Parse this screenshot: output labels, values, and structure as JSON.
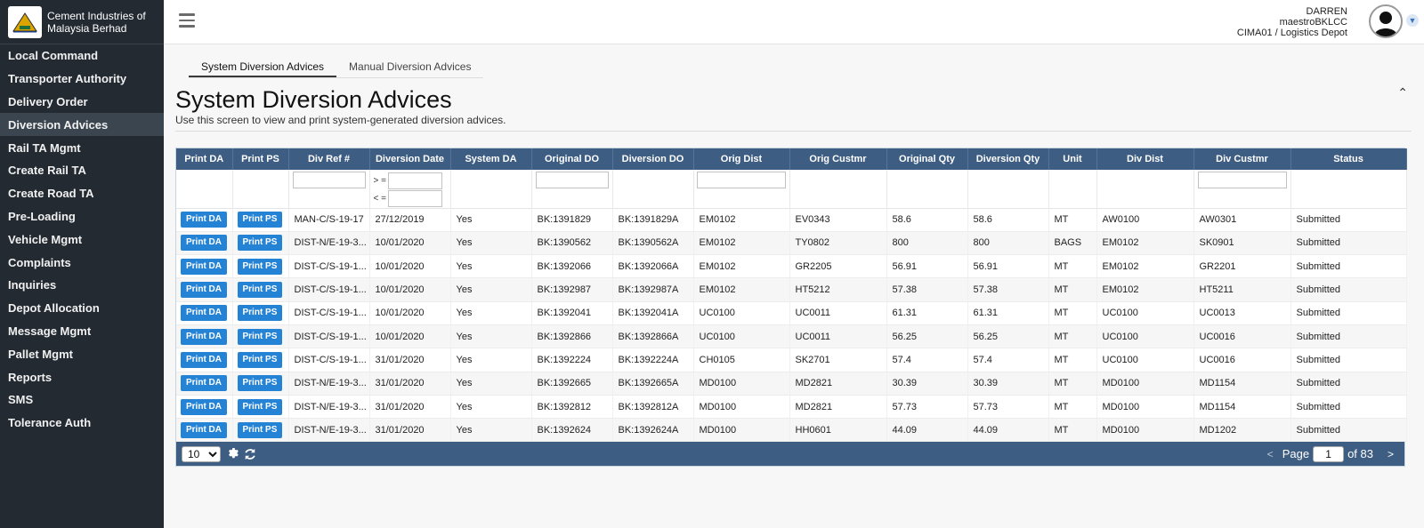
{
  "brand": {
    "name_line1": "Cement Industries of",
    "name_line2": "Malaysia Berhad"
  },
  "sidebar": {
    "items": [
      {
        "label": "Local Command"
      },
      {
        "label": "Transporter Authority"
      },
      {
        "label": "Delivery Order"
      },
      {
        "label": "Diversion Advices"
      },
      {
        "label": "Rail TA Mgmt"
      },
      {
        "label": "Create Rail TA"
      },
      {
        "label": "Create Road TA"
      },
      {
        "label": "Pre-Loading"
      },
      {
        "label": "Vehicle Mgmt"
      },
      {
        "label": "Complaints"
      },
      {
        "label": "Inquiries"
      },
      {
        "label": "Depot Allocation"
      },
      {
        "label": "Message Mgmt"
      },
      {
        "label": "Pallet Mgmt"
      },
      {
        "label": "Reports"
      },
      {
        "label": "SMS"
      },
      {
        "label": "Tolerance Auth"
      }
    ],
    "active_item": "Diversion Advices"
  },
  "header": {
    "user_name": "DARREN",
    "user_id": "maestroBKLCC",
    "user_location": "CIMA01 / Logistics Depot"
  },
  "tabs": [
    {
      "label": "System Diversion Advices"
    },
    {
      "label": "Manual Diversion Advices"
    }
  ],
  "page": {
    "title": "System Diversion Advices",
    "description": "Use this screen to view and print system-generated diversion advices."
  },
  "grid": {
    "columns": [
      "Print DA",
      "Print PS",
      "Div Ref #",
      "Diversion Date",
      "System DA",
      "Original DO",
      "Diversion DO",
      "Orig Dist",
      "Orig Custmr",
      "Original Qty",
      "Diversion Qty",
      "Unit",
      "Div Dist",
      "Div Custmr",
      "Status"
    ],
    "filters": {
      "date_from_label": "> =",
      "date_to_label": "< ="
    },
    "button_labels": {
      "print_da": "Print DA",
      "print_ps": "Print PS"
    },
    "rows": [
      [
        "MAN-C/S-19-17",
        "27/12/2019",
        "Yes",
        "BK:1391829",
        "BK:1391829A",
        "EM0102",
        "EV0343",
        "58.6",
        "58.6",
        "MT",
        "AW0100",
        "AW0301",
        "Submitted"
      ],
      [
        "DIST-N/E-19-3...",
        "10/01/2020",
        "Yes",
        "BK:1390562",
        "BK:1390562A",
        "EM0102",
        "TY0802",
        "800",
        "800",
        "BAGS",
        "EM0102",
        "SK0901",
        "Submitted"
      ],
      [
        "DIST-C/S-19-1...",
        "10/01/2020",
        "Yes",
        "BK:1392066",
        "BK:1392066A",
        "EM0102",
        "GR2205",
        "56.91",
        "56.91",
        "MT",
        "EM0102",
        "GR2201",
        "Submitted"
      ],
      [
        "DIST-C/S-19-1...",
        "10/01/2020",
        "Yes",
        "BK:1392987",
        "BK:1392987A",
        "EM0102",
        "HT5212",
        "57.38",
        "57.38",
        "MT",
        "EM0102",
        "HT5211",
        "Submitted"
      ],
      [
        "DIST-C/S-19-1...",
        "10/01/2020",
        "Yes",
        "BK:1392041",
        "BK:1392041A",
        "UC0100",
        "UC0011",
        "61.31",
        "61.31",
        "MT",
        "UC0100",
        "UC0013",
        "Submitted"
      ],
      [
        "DIST-C/S-19-1...",
        "10/01/2020",
        "Yes",
        "BK:1392866",
        "BK:1392866A",
        "UC0100",
        "UC0011",
        "56.25",
        "56.25",
        "MT",
        "UC0100",
        "UC0016",
        "Submitted"
      ],
      [
        "DIST-C/S-19-1...",
        "31/01/2020",
        "Yes",
        "BK:1392224",
        "BK:1392224A",
        "CH0105",
        "SK2701",
        "57.4",
        "57.4",
        "MT",
        "UC0100",
        "UC0016",
        "Submitted"
      ],
      [
        "DIST-N/E-19-3...",
        "31/01/2020",
        "Yes",
        "BK:1392665",
        "BK:1392665A",
        "MD0100",
        "MD2821",
        "30.39",
        "30.39",
        "MT",
        "MD0100",
        "MD1154",
        "Submitted"
      ],
      [
        "DIST-N/E-19-3...",
        "31/01/2020",
        "Yes",
        "BK:1392812",
        "BK:1392812A",
        "MD0100",
        "MD2821",
        "57.73",
        "57.73",
        "MT",
        "MD0100",
        "MD1154",
        "Submitted"
      ],
      [
        "DIST-N/E-19-3...",
        "31/01/2020",
        "Yes",
        "BK:1392624",
        "BK:1392624A",
        "MD0100",
        "HH0601",
        "44.09",
        "44.09",
        "MT",
        "MD0100",
        "MD1202",
        "Submitted"
      ]
    ]
  },
  "pager": {
    "page_size": "10",
    "page_label": "Page",
    "current_page": "1",
    "of_label": "of 83",
    "prev_icon": "chevron-left-icon",
    "next_icon": "chevron-right-icon"
  },
  "colors": {
    "sidebar_bg": "#232a32",
    "grid_header_bg": "#3e5d82",
    "button_blue": "#2583d6"
  }
}
